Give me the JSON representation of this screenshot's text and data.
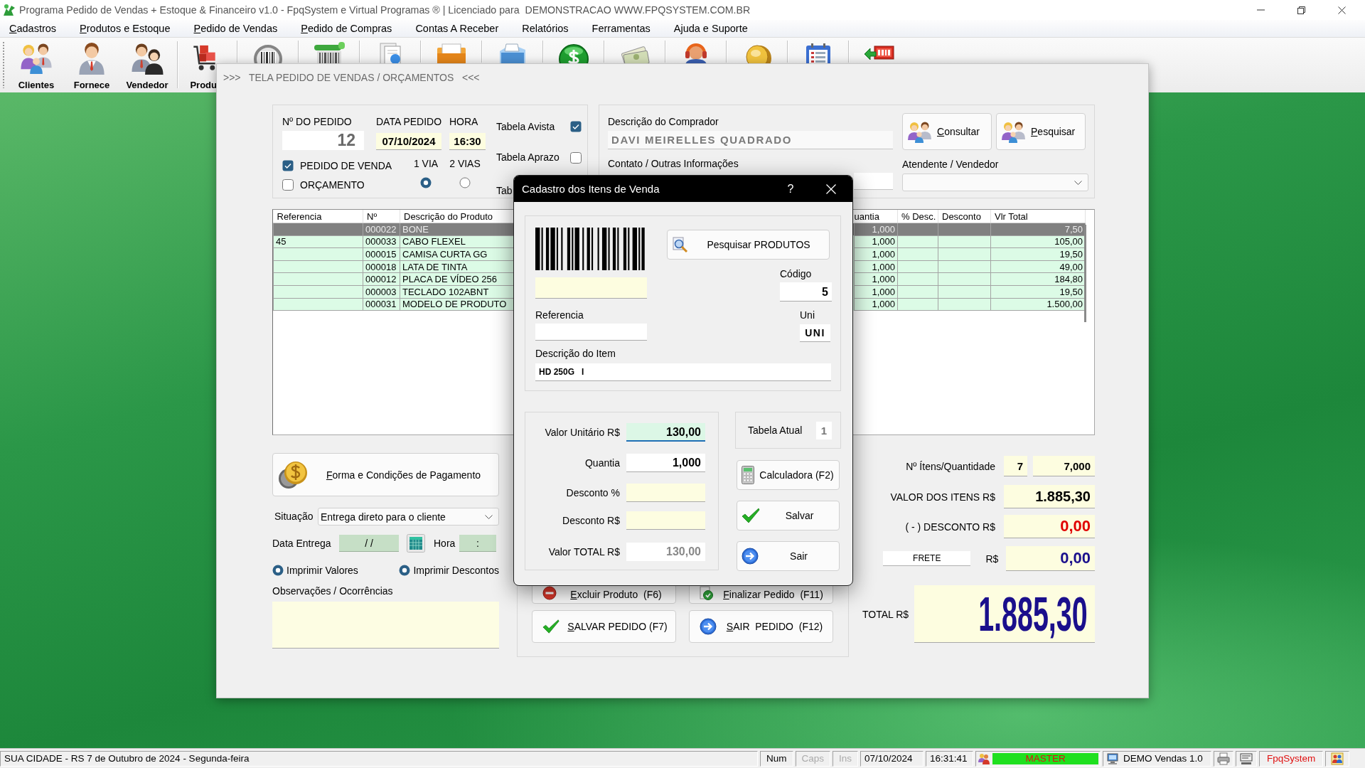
{
  "window": {
    "title": "Programa Pedido de Vendas + Estoque & Financeiro v1.0 - FpqSystem e Virtual Programas ® | Licenciado para  DEMONSTRACAO WWW.FPQSYSTEM.COM.BR"
  },
  "menu": [
    {
      "label": "Cadastros",
      "mnemonic": true
    },
    {
      "label": "Produtos e Estoque",
      "mnemonic": true
    },
    {
      "label": "Pedido de Vendas",
      "mnemonic": true
    },
    {
      "label": "Pedido de Compras",
      "mnemonic": true
    },
    {
      "label": "Contas A Receber",
      "mnemonic": false
    },
    {
      "label": "Relatórios",
      "mnemonic": false
    },
    {
      "label": "Ferramentas",
      "mnemonic": false
    },
    {
      "label": "Ajuda e Suporte",
      "mnemonic": false
    }
  ],
  "toolbar": [
    {
      "label": "Clientes"
    },
    {
      "label": "Fornece"
    },
    {
      "label": "Vendedor"
    },
    {
      "label": "Produ"
    }
  ],
  "form": {
    "title": ">>>   TELA PEDIDO DE VENDAS / ORÇAMENTOS   <<<",
    "order": {
      "number_label": "Nº DO PEDIDO",
      "number": "12",
      "date_label": "DATA PEDIDO",
      "date": "07/10/2024",
      "time_label": "HORA",
      "time": "16:30"
    },
    "doc_types": [
      {
        "label": "PEDIDO DE VENDA",
        "checked": true
      },
      {
        "label": "ORÇAMENTO",
        "checked": false
      }
    ],
    "copies": [
      {
        "label": "1 VIA",
        "selected": true
      },
      {
        "label": "2 VIAS",
        "selected": false
      }
    ],
    "price_tables": [
      {
        "label": "Tabela Avista",
        "checked": true
      },
      {
        "label": "Tabela Aprazo",
        "checked": false
      }
    ],
    "price_table_cut": "Tab",
    "buyer": {
      "label": "Descrição do Comprador",
      "value": "DAVI MEIRELLES QUADRADO"
    },
    "buyer_buttons": [
      {
        "label": "Consultar",
        "mnemonic": true
      },
      {
        "label": "Pesquisar",
        "mnemonic": true
      }
    ],
    "contact": {
      "label": "Contato / Outras Informações"
    },
    "attendant": {
      "label": "Atendente / Vendedor"
    },
    "table": {
      "columns": [
        "Referencia",
        "Nº",
        "Descrição do Produto",
        "uantia",
        "% Desc.",
        "Desconto",
        "Vlr Total"
      ],
      "rows": [
        {
          "numero": "000022",
          "descricao": "BONE",
          "column_4": "1,000",
          "vlr_total": "7,50",
          "selected": true
        },
        {
          "referencia": "45",
          "numero": "000033",
          "descricao": "CABO FLEXEL",
          "column_4": "1,000",
          "vlr_total": "105,00",
          "selected": false
        },
        {
          "numero": "000015",
          "descricao": "CAMISA CURTA GG",
          "column_4": "1,000",
          "vlr_total": "19,50",
          "selected": false
        },
        {
          "numero": "000018",
          "descricao": "LATA DE TINTA",
          "column_4": "1,000",
          "vlr_total": "49,00",
          "selected": false
        },
        {
          "numero": "000012",
          "descricao": "PLACA DE VÍDEO 256",
          "column_4": "1,000",
          "vlr_total": "184,80",
          "selected": false
        },
        {
          "numero": "000003",
          "descricao": "TECLADO 102ABNT",
          "column_4": "1,000",
          "vlr_total": "19,50",
          "selected": false
        },
        {
          "numero": "000031",
          "descricao": "MODELO DE PRODUTO",
          "column_4": "1,000",
          "vlr_total": "1.500,00",
          "selected": false
        }
      ]
    },
    "payment_button": {
      "label": "Forma e Condições de Pagamento",
      "mnemonic": true
    },
    "situation": {
      "label": "Situação",
      "value": "Entrega direto para o cliente"
    },
    "delivery": {
      "date_label": "Data Entrega",
      "date": "/ /",
      "time_label": "Hora",
      "time": ":"
    },
    "print_options": [
      {
        "label": "Imprimir Valores",
        "selected": true
      },
      {
        "label": "Imprimir Descontos",
        "selected": true
      }
    ],
    "notes": {
      "label": "Observações / Ocorrências"
    },
    "actions": [
      {
        "label": "Excluir Produto  (F6)",
        "mnemonic": true
      },
      {
        "label": "Finalizar Pedido  (F11)",
        "mnemonic": true
      },
      {
        "label": "SALVAR PEDIDO (F7)",
        "mnemonic": true
      },
      {
        "label": "SAIR  PEDIDO  (F12)",
        "mnemonic": true
      }
    ],
    "totals": {
      "count_label": "Nº Ítens/Quantidade",
      "count": "7",
      "quantity": "7,000",
      "items_label": "VALOR DOS ITENS R$",
      "items_value": "1.885,30",
      "discount_label": "( - ) DESCONTO R$",
      "discount": "0,00",
      "freight_label": "FRETE",
      "freight_currency": "R$",
      "freight": "0,00",
      "total_label": "TOTAL R$",
      "total": "1.885,30"
    }
  },
  "dialog": {
    "title": "Cadastro dos Itens de Venda",
    "help": "?",
    "search_button": "Pesquisar PRODUTOS",
    "code": {
      "label": "Código",
      "value": "5"
    },
    "reference": {
      "label": "Referencia"
    },
    "unit": {
      "label": "Uni",
      "value": "UNI"
    },
    "description": {
      "label": "Descrição do Item",
      "value": "HD 250G   I"
    },
    "fields": [
      {
        "label": "Valor Unitário R$",
        "value": "130,00",
        "kind": "focused"
      },
      {
        "label": "Quantia",
        "value": "1,000",
        "kind": "value"
      },
      {
        "label": "Desconto %",
        "kind": "input"
      },
      {
        "label": "Desconto R$",
        "kind": "input"
      },
      {
        "label": "Valor TOTAL R$",
        "value": "130,00",
        "kind": "total"
      }
    ],
    "price_table": {
      "label": "Tabela Atual",
      "value": "1"
    },
    "buttons": [
      {
        "label": "Calculadora (F2)"
      },
      {
        "label": "Salvar"
      },
      {
        "label": "Sair"
      }
    ]
  },
  "status_bar": {
    "location": "SUA CIDADE - RS  7 de Outubro de 2024 - Segunda-feira",
    "keys": [
      {
        "label": "Num",
        "on": true
      },
      {
        "label": "Caps",
        "on": false
      },
      {
        "label": "Ins",
        "on": false
      }
    ],
    "date": "07/10/2024",
    "time": "16:31:41",
    "user": "MASTER",
    "app": "DEMO Vendas 1.0",
    "brand": "FpqSystem"
  }
}
